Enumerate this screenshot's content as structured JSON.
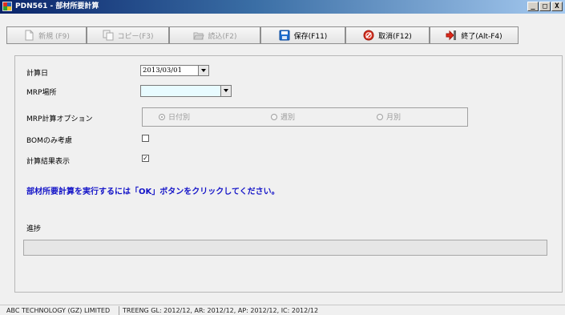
{
  "window": {
    "title": "PDN561 - 部材所要計算",
    "minimize": "_",
    "maximize": "□",
    "close": "X"
  },
  "toolbar": {
    "new_label": "新規 (F9)",
    "copy_label": "コピー(F3)",
    "load_label": "読込(F2)",
    "save_label": "保存(F11)",
    "cancel_label": "取消(F12)",
    "exit_label": "終了(Alt-F4)"
  },
  "form": {
    "calc_date_label": "計算日",
    "calc_date_value": "2013/03/01",
    "mrp_location_label": "MRP場所",
    "mrp_location_value": "",
    "mrp_option_label": "MRP計算オプション",
    "options": [
      {
        "label": "日付別",
        "selected": true
      },
      {
        "label": "週別",
        "selected": false
      },
      {
        "label": "月別",
        "selected": false
      }
    ],
    "bom_only_label": "BOMのみ考慮",
    "bom_only_checked": false,
    "show_result_label": "計算結果表示",
    "show_result_checked": true,
    "check_mark": "✓",
    "info_message": "部材所要計算を実行するには「OK」ボタンをクリックしてください。",
    "progress_label": "進捗",
    "progress_value": 0
  },
  "status": {
    "company": "ABC TECHNOLOGY (GZ) LIMITED",
    "periods": "TREENG  GL: 2012/12, AR: 2012/12, AP: 2012/12, IC: 2012/12"
  },
  "colors": {
    "info_text": "#1414c8",
    "title_bar_start": "#0a246a",
    "title_bar_end": "#a6caf0"
  }
}
